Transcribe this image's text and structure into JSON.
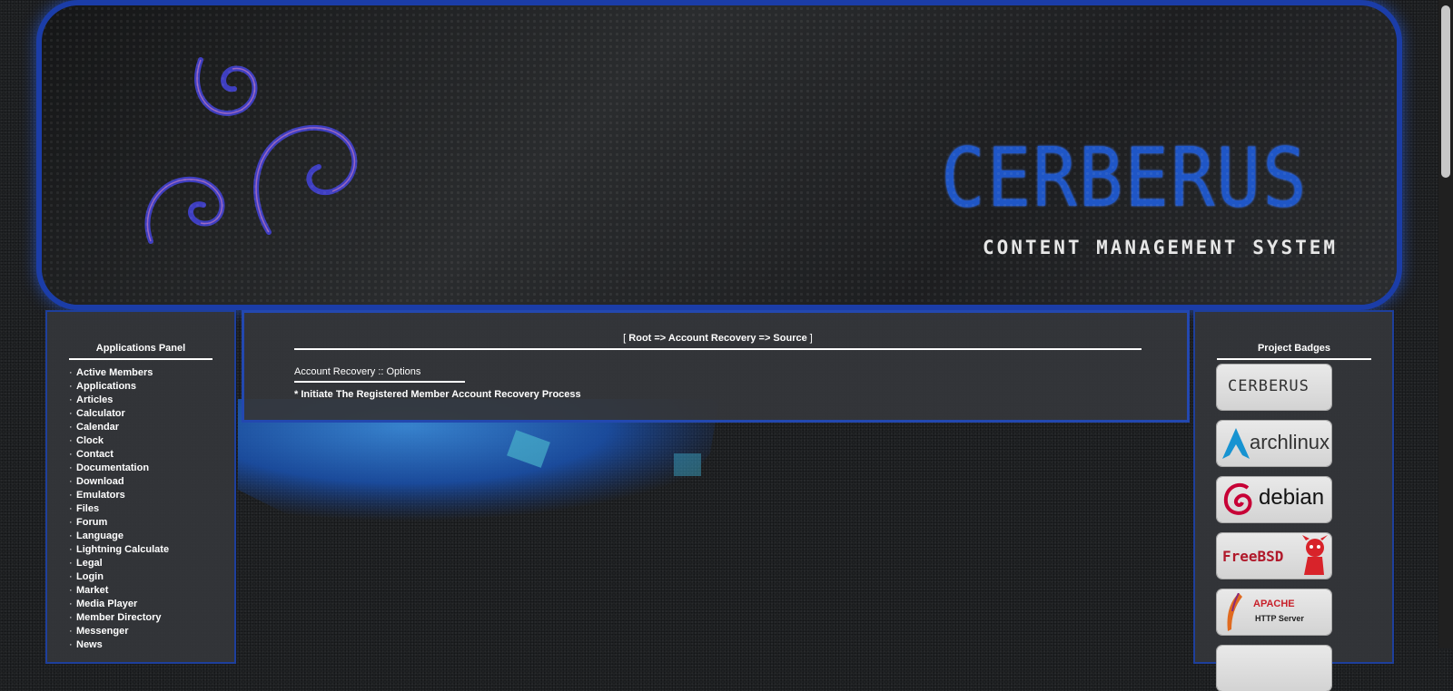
{
  "banner": {
    "title": "CERBERUS",
    "subtitle": "CONTENT MANAGEMENT SYSTEM"
  },
  "applications_panel": {
    "heading": "Applications Panel",
    "bullet": "·",
    "items": [
      "Active Members",
      "Applications",
      "Articles",
      "Calculator",
      "Calendar",
      "Clock",
      "Contact",
      "Documentation",
      "Download",
      "Emulators",
      "Files",
      "Forum",
      "Language",
      "Lightning Calculate",
      "Legal",
      "Login",
      "Market",
      "Media Player",
      "Member Directory",
      "Messenger",
      "News"
    ]
  },
  "main": {
    "breadcrumb_open": "[ ",
    "breadcrumb_path": "Root => Account Recovery => Source",
    "breadcrumb_close": " ]",
    "section_title": "Account Recovery :: Options",
    "link_prefix": "* ",
    "link_label": "Initiate The Registered Member Account Recovery Process"
  },
  "badges_panel": {
    "heading": "Project Badges",
    "badges": {
      "cerberus": "CERBERUS",
      "arch": "archlinux",
      "debian": "debian",
      "freebsd": "FreeBSD",
      "apache_line1": "APACHE",
      "apache_line2": "HTTP Server"
    }
  },
  "colors": {
    "accent_blue": "#1f56c6",
    "panel_border": "#1e3f9c",
    "panel_bg": "#34363a"
  }
}
